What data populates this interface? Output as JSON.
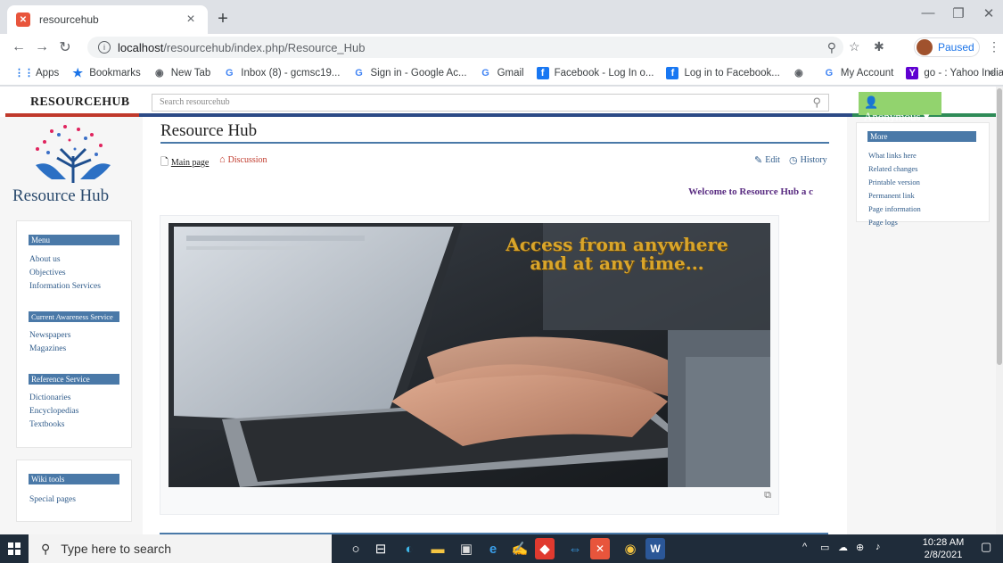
{
  "browser": {
    "tab_title": "resourcehub",
    "tab_close": "×",
    "new_tab": "+",
    "url_host": "localhost",
    "url_path": "/resourcehub/index.php/Resource_Hub",
    "profile_status": "Paused",
    "bookmarks": [
      {
        "label": "Apps",
        "icon": "apps-icon"
      },
      {
        "label": "Bookmarks",
        "icon": "star-icon"
      },
      {
        "label": "New Tab",
        "icon": "globe-icon"
      },
      {
        "label": "Inbox (8) - gcmsc19...",
        "icon": "google-icon"
      },
      {
        "label": "Sign in - Google Ac...",
        "icon": "google-icon"
      },
      {
        "label": "Gmail",
        "icon": "google-icon"
      },
      {
        "label": "Facebook - Log In o...",
        "icon": "facebook-icon"
      },
      {
        "label": "Log in to Facebook...",
        "icon": "facebook-icon"
      },
      {
        "label": "",
        "icon": "globe-icon"
      },
      {
        "label": "My Account",
        "icon": "google-icon"
      },
      {
        "label": "go - : Yahoo India S...",
        "icon": "yahoo-icon"
      }
    ],
    "bookmarks_more": "»"
  },
  "wiki": {
    "brand": "RESOURCEHUB",
    "search_placeholder": "Search resourcehub",
    "user_menu": "Anonymous",
    "logo_text": "Resource Hub",
    "page_title": "Resource Hub",
    "tabs": {
      "main": "Main page",
      "discussion": "Discussion",
      "edit": "Edit",
      "history": "History"
    },
    "welcome": "Welcome to Resource Hub a c",
    "image_caption_line1": "Access from anywhere",
    "image_caption_line2": "and at any time...",
    "sidebar": {
      "menu_heading": "Menu",
      "menu_items": [
        "About us",
        "Objectives",
        "Information Services"
      ],
      "cas_heading": "Current Awareness Service",
      "cas_items": [
        "Newspapers",
        "Magazines"
      ],
      "ref_heading": "Reference Service",
      "ref_items": [
        "Dictionaries",
        "Encyclopedias",
        "Textbooks"
      ],
      "tools_heading": "Wiki tools",
      "tools_items": [
        "Special pages"
      ]
    },
    "more_panel": {
      "heading": "More",
      "items": [
        "What links here",
        "Related changes",
        "Printable version",
        "Permanent link",
        "Page information",
        "Page logs"
      ]
    }
  },
  "taskbar": {
    "search_placeholder": "Type here to search",
    "time": "10:28 AM",
    "date": "2/8/2021"
  }
}
